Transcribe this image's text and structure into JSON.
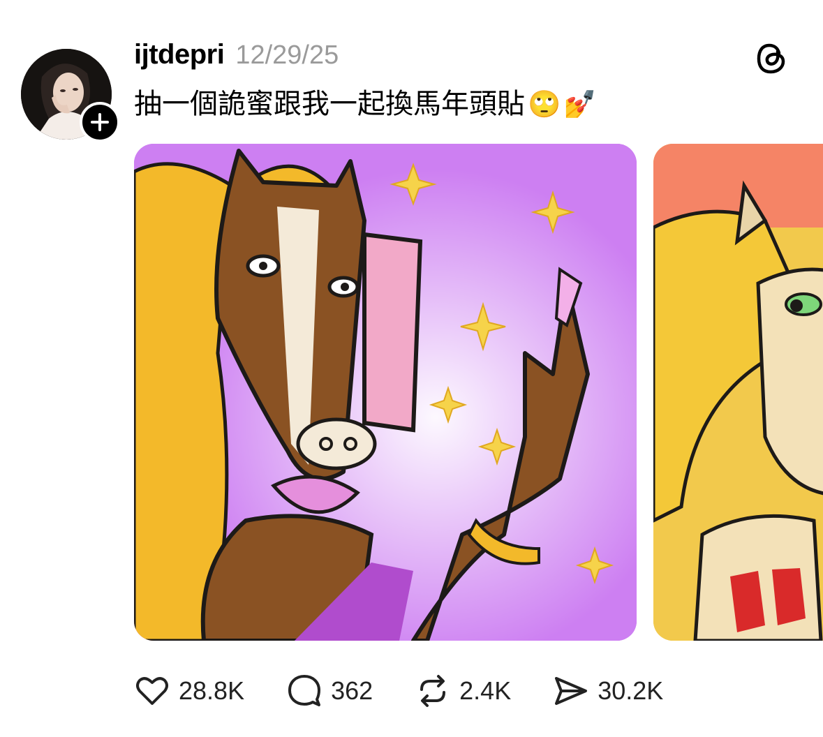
{
  "post": {
    "username": "ijtdepri",
    "timestamp": "12/29/25",
    "caption": "抽一個詭蜜跟我一起換馬年頭貼",
    "caption_emojis": [
      "🙄",
      "💅"
    ]
  },
  "icons": {
    "follow": "plus-icon",
    "app": "threads-logo-icon",
    "like": "heart-icon",
    "reply": "comment-icon",
    "repost": "repost-icon",
    "share": "send-icon"
  },
  "stats": {
    "likes": "28.8K",
    "replies": "362",
    "reposts": "2.4K",
    "shares": "30.2K"
  }
}
